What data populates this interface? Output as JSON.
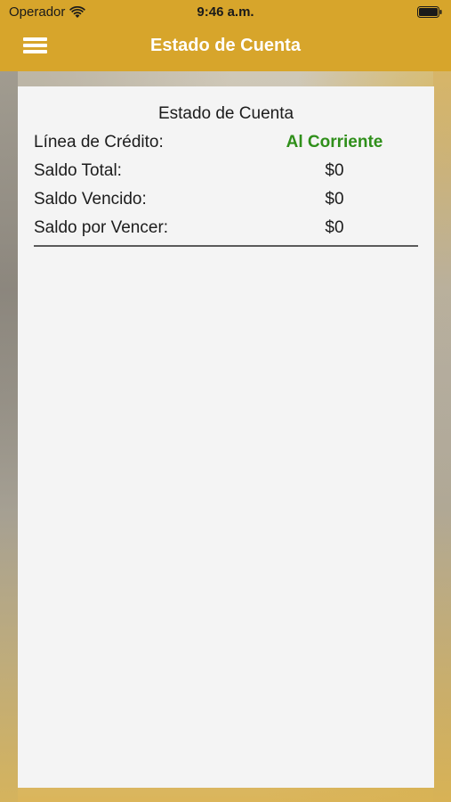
{
  "status_bar": {
    "carrier": "Operador",
    "time": "9:46 a.m."
  },
  "nav": {
    "title": "Estado de Cuenta"
  },
  "card": {
    "title": "Estado de Cuenta",
    "rows": [
      {
        "label": "Línea de Crédito:",
        "value": "Al Corriente"
      },
      {
        "label": "Saldo Total:",
        "value": "$0"
      },
      {
        "label": "Saldo Vencido:",
        "value": "$0"
      },
      {
        "label": "Saldo por Vencer:",
        "value": "$0"
      }
    ]
  },
  "colors": {
    "header": "#d7a52b",
    "status_ok": "#2f8f1a"
  },
  "icons": {
    "menu": "hamburger-menu-icon",
    "wifi": "wifi-icon",
    "battery": "battery-icon"
  }
}
